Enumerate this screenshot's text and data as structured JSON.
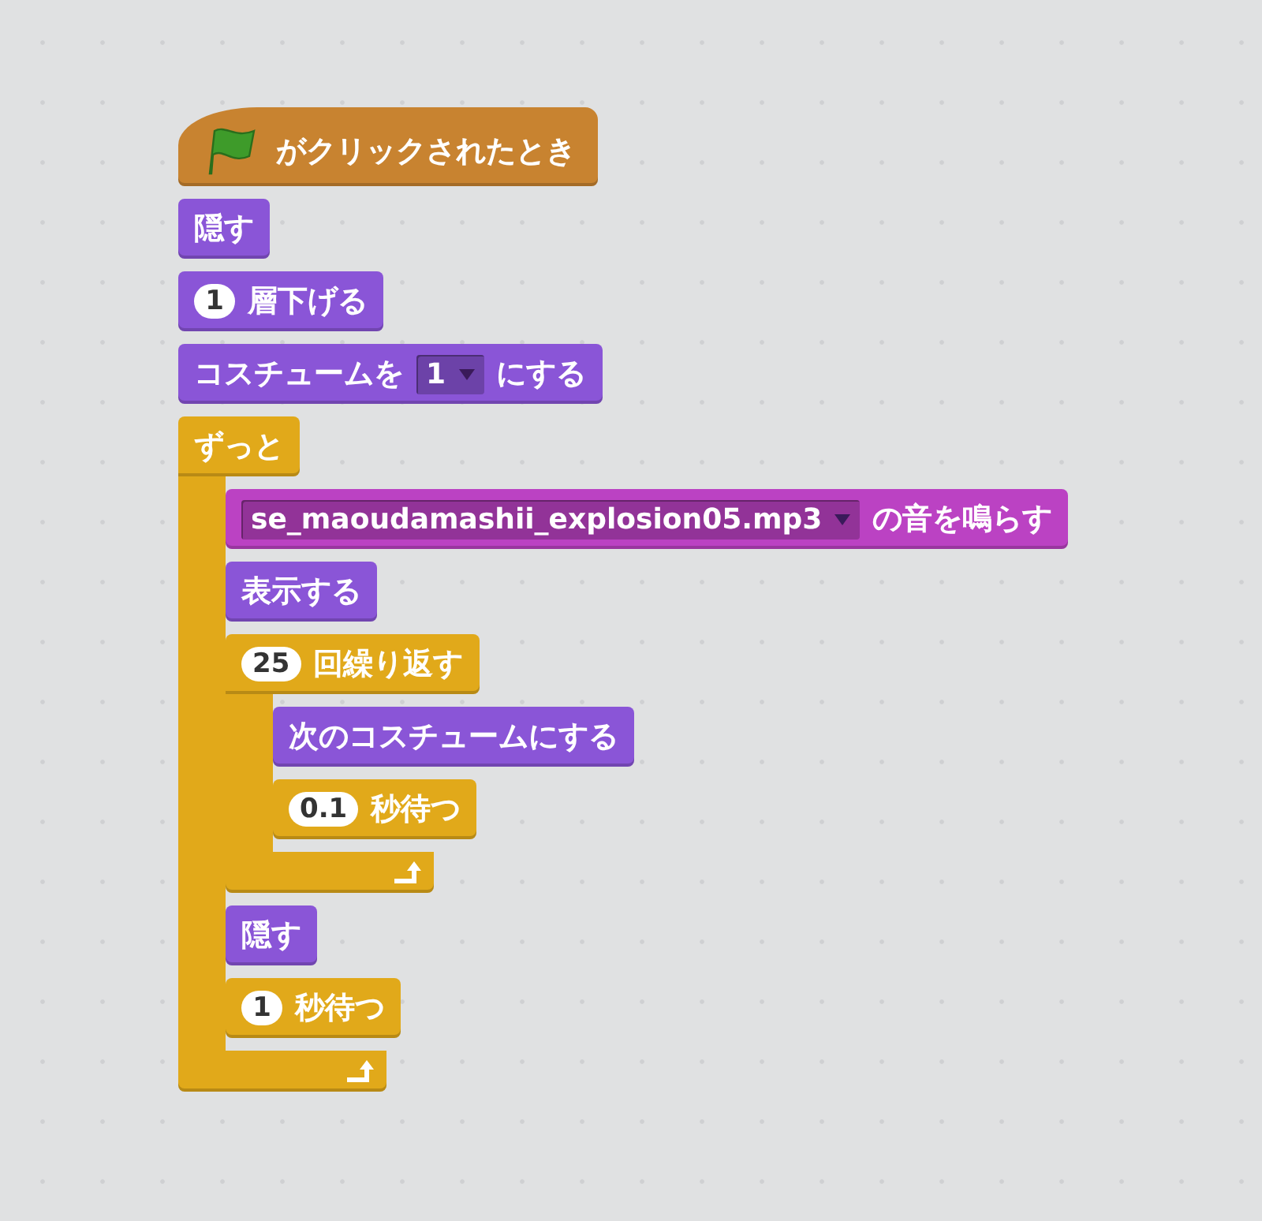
{
  "script": [
    {
      "kind": "hat",
      "color": "#c88330",
      "parts": [
        {
          "kind": "flag"
        },
        {
          "kind": "text",
          "text": "がクリックされたとき"
        }
      ]
    },
    {
      "kind": "command",
      "color": "#8a55d7",
      "parts": [
        {
          "kind": "text",
          "text": "隠す"
        }
      ]
    },
    {
      "kind": "command",
      "color": "#8a55d7",
      "parts": [
        {
          "kind": "number",
          "text": "1"
        },
        {
          "kind": "text",
          "text": "層下げる"
        }
      ]
    },
    {
      "kind": "command",
      "color": "#8a55d7",
      "parts": [
        {
          "kind": "text",
          "text": "コスチュームを"
        },
        {
          "kind": "dropdown",
          "text": "1"
        },
        {
          "kind": "text",
          "text": "にする"
        }
      ]
    },
    {
      "kind": "c",
      "color": "#e1a91a",
      "parts": [
        {
          "kind": "text",
          "text": "ずっと"
        }
      ],
      "children": [
        {
          "kind": "command",
          "color": "#bb42c3",
          "parts": [
            {
              "kind": "dropdown",
              "text": "se_maoudamashii_explosion05.mp3"
            },
            {
              "kind": "text",
              "text": "の音を鳴らす"
            }
          ]
        },
        {
          "kind": "command",
          "color": "#8a55d7",
          "parts": [
            {
              "kind": "text",
              "text": "表示する"
            }
          ]
        },
        {
          "kind": "c",
          "color": "#e1a91a",
          "parts": [
            {
              "kind": "number",
              "text": "25"
            },
            {
              "kind": "text",
              "text": "回繰り返す"
            }
          ],
          "children": [
            {
              "kind": "command",
              "color": "#8a55d7",
              "parts": [
                {
                  "kind": "text",
                  "text": "次のコスチュームにする"
                }
              ]
            },
            {
              "kind": "command",
              "color": "#e1a91a",
              "parts": [
                {
                  "kind": "number",
                  "text": "0.1"
                },
                {
                  "kind": "text",
                  "text": "秒待つ"
                }
              ]
            }
          ]
        },
        {
          "kind": "command",
          "color": "#8a55d7",
          "parts": [
            {
              "kind": "text",
              "text": "隠す"
            }
          ]
        },
        {
          "kind": "command",
          "color": "#e1a91a",
          "parts": [
            {
              "kind": "number",
              "text": "1"
            },
            {
              "kind": "text",
              "text": "秒待つ"
            }
          ]
        }
      ]
    }
  ]
}
